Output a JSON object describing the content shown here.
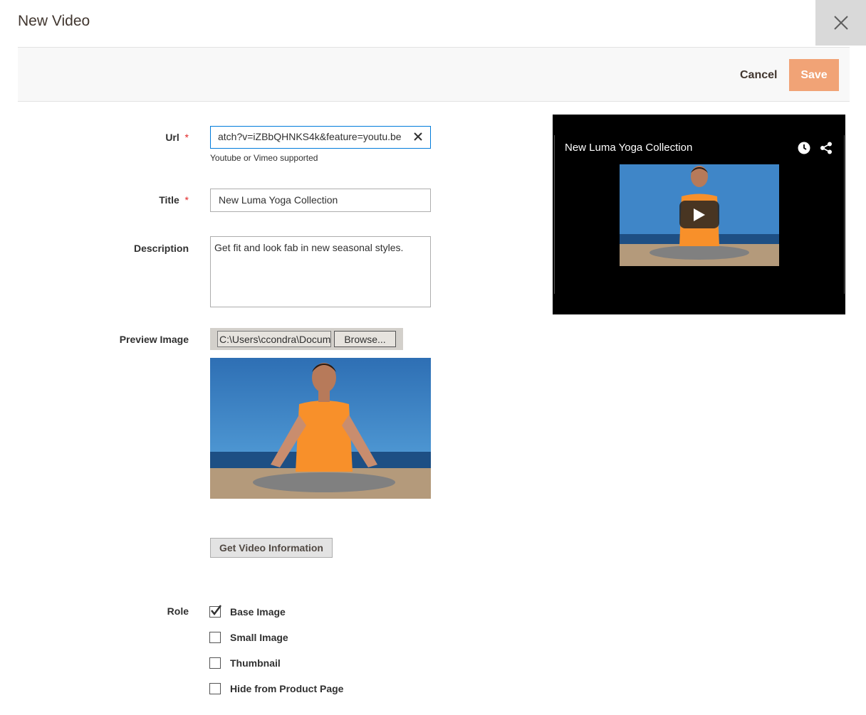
{
  "modal": {
    "title": "New Video"
  },
  "toolbar": {
    "cancel_label": "Cancel",
    "save_label": "Save"
  },
  "form": {
    "url": {
      "label": "Url",
      "value": "atch?v=iZBbQHNKS4k&feature=youtu.be",
      "note": "Youtube or Vimeo supported"
    },
    "title": {
      "label": "Title",
      "value": "New Luma Yoga Collection"
    },
    "description": {
      "label": "Description",
      "value": "Get fit and look fab in new seasonal styles."
    },
    "preview_image": {
      "label": "Preview Image",
      "file_path": "C:\\Users\\ccondra\\Documents",
      "browse_label": "Browse..."
    },
    "get_info_label": "Get Video Information",
    "role": {
      "label": "Role",
      "options": [
        {
          "label": "Base Image",
          "checked": true
        },
        {
          "label": "Small Image",
          "checked": false
        },
        {
          "label": "Thumbnail",
          "checked": false
        },
        {
          "label": "Hide from Product Page",
          "checked": false
        }
      ]
    }
  },
  "video_preview": {
    "title": "New Luma Yoga Collection"
  },
  "colors": {
    "save_bg": "#f1a376",
    "required": "#e22626",
    "focus_border": "#007bdb"
  }
}
